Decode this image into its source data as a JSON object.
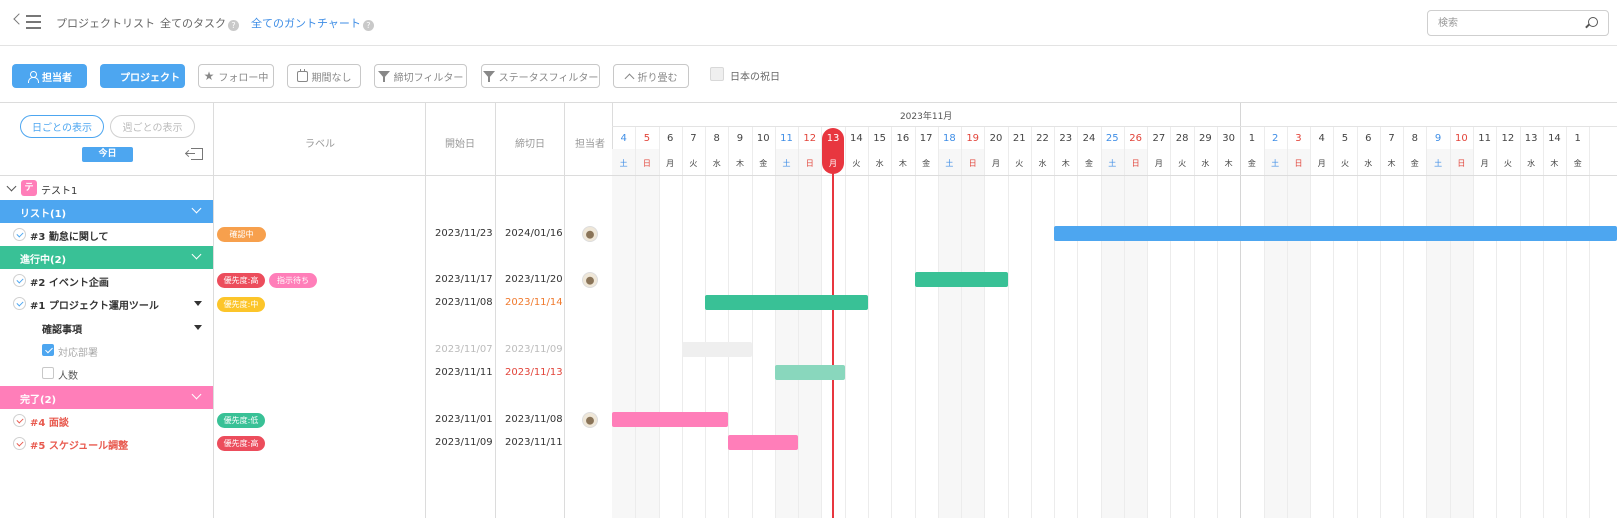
{
  "nav": {
    "links": [
      "プロジェクトリスト",
      "全てのタスク",
      "全てのガントチャート"
    ],
    "help_mark": "?",
    "search_placeholder": "検索"
  },
  "toolbar": {
    "assignee": "担当者",
    "project": "プロジェクト",
    "follow": "フォロー中",
    "no_period": "期間なし",
    "deadline_filter": "締切フィルター",
    "status_filter": "ステータスフィルター",
    "fold": "折り畳む",
    "holidays": "日本の祝日",
    "holidays_checked": false
  },
  "table_header": {
    "daily_view": "日ごとの表示",
    "weekly_view": "週ごとの表示",
    "today": "今日",
    "label": "ラベル",
    "start": "開始日",
    "end": "締切日",
    "assignee": "担当者"
  },
  "project": {
    "badge": "テ",
    "name": "テスト1"
  },
  "groups": [
    {
      "label": "リスト(1)",
      "color": "#4da6f0"
    },
    {
      "label": "進行中(2)",
      "color": "#39c196"
    },
    {
      "label": "完了(2)",
      "color": "#ff7eb9"
    }
  ],
  "tasks": [
    {
      "name": "#3 勤怠に関して",
      "tags": [
        {
          "text": "確認中",
          "color": "#f7a04d"
        }
      ],
      "start": "2023/11/23",
      "end": "2024/01/16",
      "avatar": true,
      "bar": {
        "from": "2023/11/23",
        "to": "2024/01/16",
        "color": "#4da6f0"
      }
    },
    {
      "name": "#2 イベント企画",
      "tags": [
        {
          "text": "優先度:高",
          "color": "#ec4d5c"
        },
        {
          "text": "指示待ち",
          "color": "#ff7eb9"
        }
      ],
      "start": "2023/11/17",
      "end": "2023/11/20",
      "avatar": true,
      "bar": {
        "from": "2023/11/17",
        "to": "2023/11/20",
        "color": "#39c196"
      }
    },
    {
      "name": "#1 プロジェクト運用ツール",
      "tags": [
        {
          "text": "優先度:中",
          "color": "#fcc52a"
        }
      ],
      "start": "2023/11/08",
      "end": "2023/11/14",
      "avatar": false,
      "bar": {
        "from": "2023/11/08",
        "to": "2023/11/14",
        "color": "#39c196"
      }
    },
    {
      "name": "確認事項"
    },
    {
      "name": "対応部署",
      "start": "2023/11/07",
      "end": "2023/11/09",
      "bar": {
        "from": "2023/11/07",
        "to": "2023/11/09",
        "color": "#efefef"
      }
    },
    {
      "name": "人数",
      "start": "2023/11/11",
      "end": "2023/11/13",
      "bar": {
        "from": "2023/11/11",
        "to": "2023/11/13",
        "color": "#89d7bd"
      }
    },
    {
      "name": "#4 面談",
      "tags": [
        {
          "text": "優先度:低",
          "color": "#39c196"
        }
      ],
      "start": "2023/11/01",
      "end": "2023/11/08",
      "avatar": true,
      "bar": {
        "from": "2023/11/01",
        "to": "2023/11/08",
        "color": "#ff7eb9"
      }
    },
    {
      "name": "#5 スケジュール調整",
      "tags": [
        {
          "text": "優先度:高",
          "color": "#ec4d5c"
        }
      ],
      "start": "2023/11/09",
      "end": "2023/11/11",
      "avatar": false,
      "bar": {
        "from": "2023/11/09",
        "to": "2023/11/11",
        "color": "#ff7eb9"
      }
    }
  ],
  "gantt": {
    "month_label": "2023年11月",
    "today": "2023/11/13",
    "days": [
      {
        "d": "4",
        "w": "土"
      },
      {
        "d": "5",
        "w": "日"
      },
      {
        "d": "6",
        "w": "月"
      },
      {
        "d": "7",
        "w": "火"
      },
      {
        "d": "8",
        "w": "水"
      },
      {
        "d": "9",
        "w": "木"
      },
      {
        "d": "10",
        "w": "金"
      },
      {
        "d": "11",
        "w": "土"
      },
      {
        "d": "12",
        "w": "日"
      },
      {
        "d": "13",
        "w": "月"
      },
      {
        "d": "14",
        "w": "火"
      },
      {
        "d": "15",
        "w": "水"
      },
      {
        "d": "16",
        "w": "木"
      },
      {
        "d": "17",
        "w": "金"
      },
      {
        "d": "18",
        "w": "土"
      },
      {
        "d": "19",
        "w": "日"
      },
      {
        "d": "20",
        "w": "月"
      },
      {
        "d": "21",
        "w": "火"
      },
      {
        "d": "22",
        "w": "水"
      },
      {
        "d": "23",
        "w": "木"
      },
      {
        "d": "24",
        "w": "金"
      },
      {
        "d": "25",
        "w": "土"
      },
      {
        "d": "26",
        "w": "日"
      },
      {
        "d": "27",
        "w": "月"
      },
      {
        "d": "28",
        "w": "火"
      },
      {
        "d": "29",
        "w": "水"
      },
      {
        "d": "30",
        "w": "木"
      },
      {
        "d": "1",
        "w": "金"
      },
      {
        "d": "2",
        "w": "土"
      },
      {
        "d": "3",
        "w": "日"
      },
      {
        "d": "4",
        "w": "月"
      },
      {
        "d": "5",
        "w": "火"
      },
      {
        "d": "6",
        "w": "水"
      },
      {
        "d": "7",
        "w": "木"
      },
      {
        "d": "8",
        "w": "金"
      },
      {
        "d": "9",
        "w": "土"
      },
      {
        "d": "10",
        "w": "日"
      },
      {
        "d": "11",
        "w": "月"
      },
      {
        "d": "12",
        "w": "火"
      },
      {
        "d": "13",
        "w": "水"
      },
      {
        "d": "14",
        "w": "木"
      },
      {
        "d": "1",
        "w": "金"
      }
    ]
  }
}
